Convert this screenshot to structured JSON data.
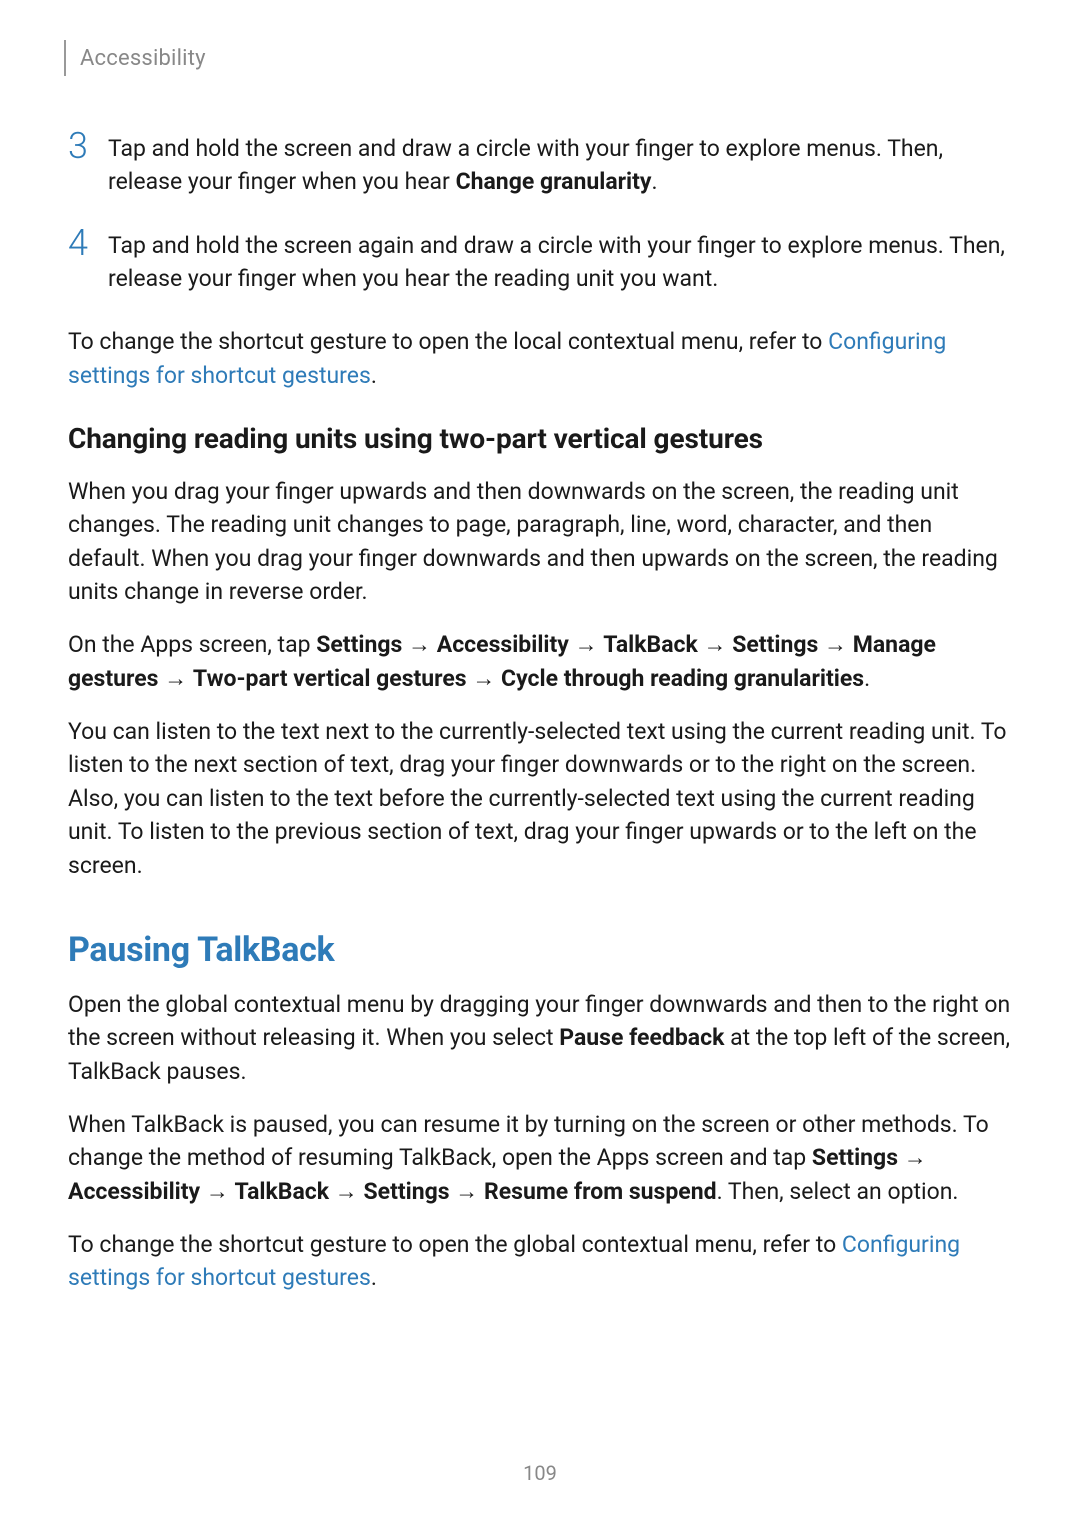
{
  "header": {
    "title": "Accessibility"
  },
  "steps": [
    {
      "number": "3",
      "text_pre": "Tap and hold the screen and draw a circle with your finger to explore menus. Then, release your finger when you hear ",
      "bold": "Change granularity",
      "text_post": "."
    },
    {
      "number": "4",
      "text_pre": "Tap and hold the screen again and draw a circle with your finger to explore menus. Then, release your finger when you hear the reading unit you want.",
      "bold": "",
      "text_post": ""
    }
  ],
  "shortcut_para": {
    "pre": "To change the shortcut gesture to open the local contextual menu, refer to ",
    "link": "Configuring settings for shortcut gestures",
    "post": "."
  },
  "section1": {
    "heading": "Changing reading units using two-part vertical gestures",
    "p1": "When you drag your finger upwards and then downwards on the screen, the reading unit changes. The reading unit changes to page, paragraph, line, word, character, and then default. When you drag your finger downwards and then upwards on the screen, the reading units change in reverse order.",
    "p2": {
      "pre": "On the Apps screen, tap ",
      "path": [
        "Settings",
        "Accessibility",
        "TalkBack",
        "Settings",
        "Manage gestures",
        "Two-part vertical gestures",
        "Cycle through reading granularities"
      ],
      "post": "."
    },
    "p3": "You can listen to the text next to the currently-selected text using the current reading unit. To listen to the next section of text, drag your finger downwards or to the right on the screen. Also, you can listen to the text before the currently-selected text using the current reading unit. To listen to the previous section of text, drag your finger upwards or to the left on the screen."
  },
  "section2": {
    "heading": "Pausing TalkBack",
    "p1": {
      "pre": "Open the global contextual menu by dragging your finger downwards and then to the right on the screen without releasing it. When you select ",
      "bold": "Pause feedback",
      "post": " at the top left of the screen, TalkBack pauses."
    },
    "p2": {
      "pre": "When TalkBack is paused, you can resume it by turning on the screen or other methods. To change the method of resuming TalkBack, open the Apps screen and tap ",
      "path": [
        "Settings",
        "Accessibility",
        "TalkBack",
        "Settings",
        "Resume from suspend"
      ],
      "post": ". Then, select an option."
    },
    "p3": {
      "pre": "To change the shortcut gesture to open the global contextual menu, refer to ",
      "link": "Configuring settings for shortcut gestures",
      "post": "."
    }
  },
  "arrow": "→",
  "page_number": "109"
}
